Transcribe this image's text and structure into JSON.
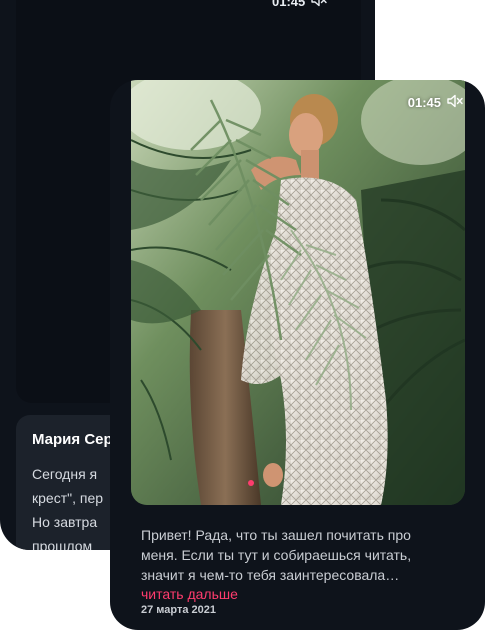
{
  "back_card": {
    "time": "01:45",
    "mute_icon": "speaker-muted-icon",
    "author": "Мария Сер",
    "text_lines": [
      "Сегодня я",
      "крест\", пер",
      "Но завтра",
      "прошлом"
    ]
  },
  "front_card": {
    "time": "01:45",
    "mute_icon": "speaker-muted-icon",
    "text_lines": [
      "Привет! Рада, что ты зашел почитать про",
      "меня. Если ты тут и собираешься читать,",
      "значит я чем-то тебя заинтересовала…"
    ],
    "read_more": "читать дальше",
    "date": "27 марта 2021",
    "carousel": {
      "count": 1,
      "active_index": 0
    }
  },
  "colors": {
    "card_bg": "#0e131b",
    "accent": "#ff3c6e",
    "info_bg": "#1c222b"
  }
}
